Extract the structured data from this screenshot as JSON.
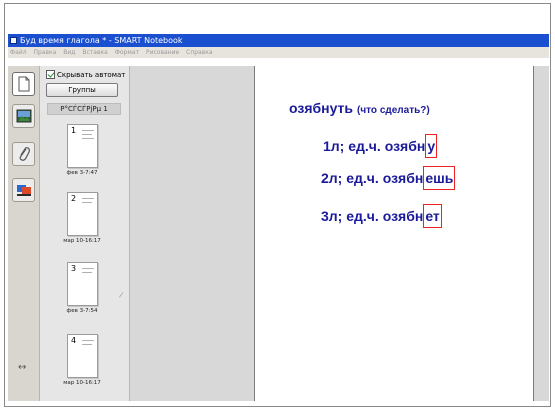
{
  "window": {
    "title": "Буд время глагола * - SMART Notebook"
  },
  "menu": [
    "Файл",
    "Правка",
    "Вид",
    "Вставка",
    "Формат",
    "Рисование",
    "Справка"
  ],
  "tabs": [
    {
      "name": "page-sorter",
      "icon": "page-sorter-icon"
    },
    {
      "name": "gallery",
      "icon": "gallery-icon"
    },
    {
      "name": "attachments",
      "icon": "paperclip-icon"
    },
    {
      "name": "properties",
      "icon": "properties-icon"
    }
  ],
  "sorter": {
    "auto_hide_label": "Скрывать автомат",
    "auto_hide_checked": true,
    "groups_button": "Группы",
    "group_label": "Р°СЃСЃРјРµ 1",
    "thumbnails": [
      {
        "number": "1",
        "caption": "фев 3-7:47"
      },
      {
        "number": "2",
        "caption": "мар 10-16:17"
      },
      {
        "number": "3",
        "caption": "фев 3-7:54"
      },
      {
        "number": "4",
        "caption": "мар 10-16:17"
      }
    ],
    "resize_glyph": "↔"
  },
  "slide": {
    "verb": "озябнуть",
    "verb_hint": "(что сделать?)",
    "forms": [
      {
        "prefix": "1л; ед.ч. озябн",
        "ending": "у"
      },
      {
        "prefix": "2л; ед.ч. озябн",
        "ending": "ешь"
      },
      {
        "prefix": "3л; ед.ч. озябн",
        "ending": "ет"
      }
    ]
  },
  "colors": {
    "titlebar": "#1a4fd0",
    "slide_text": "#1a1a9a",
    "ending_border": "#ee2222"
  }
}
